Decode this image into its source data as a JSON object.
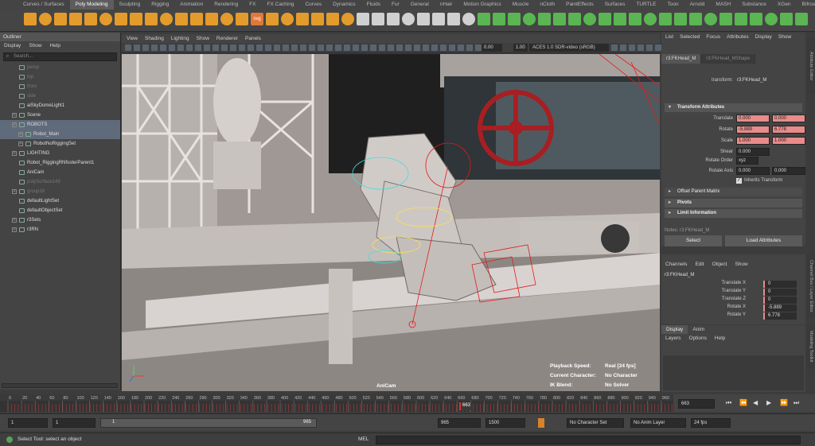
{
  "shelf": {
    "tabs": [
      "Curves / Surfaces",
      "Poly Modeling",
      "Sculpting",
      "Rigging",
      "Animation",
      "Rendering",
      "FX",
      "FX Caching",
      "Curves",
      "Dynamics",
      "Fluids",
      "Fur",
      "General",
      "nHair",
      "Motion Graphics",
      "Muscle",
      "nCloth",
      "PaintEffects",
      "Surfaces",
      "TURTLE",
      "Toon",
      "Arnold",
      "MASH",
      "Substance",
      "XGen",
      "Bifrost"
    ],
    "active_tab": "Poly Modeling",
    "svg_label": "svg"
  },
  "outliner": {
    "title": "Outliner",
    "menu": [
      "Display",
      "Show",
      "Help"
    ],
    "search_placeholder": "Search...",
    "items": [
      {
        "label": "persp",
        "dim": true,
        "exp": false,
        "child": false
      },
      {
        "label": "top",
        "dim": true,
        "exp": false,
        "child": false
      },
      {
        "label": "front",
        "dim": true,
        "exp": false,
        "child": false
      },
      {
        "label": "side",
        "dim": true,
        "exp": false,
        "child": false
      },
      {
        "label": "aiSkyDomeLight1",
        "dim": false,
        "exp": false,
        "child": false
      },
      {
        "label": "Scene",
        "dim": false,
        "exp": true,
        "child": false
      },
      {
        "label": "ROBOTS",
        "dim": false,
        "exp": true,
        "child": false,
        "sel": true
      },
      {
        "label": "Robot_Main",
        "dim": false,
        "exp": true,
        "child": true,
        "sel": true
      },
      {
        "label": "RobotNoRiggingSet",
        "dim": false,
        "exp": true,
        "child": true
      },
      {
        "label": "LIGHTING",
        "dim": false,
        "exp": true,
        "child": false
      },
      {
        "label": "Robot_RiggingRNfosterParent1",
        "dim": false,
        "exp": false,
        "child": false
      },
      {
        "label": "AniCam",
        "dim": false,
        "exp": false,
        "child": false
      },
      {
        "label": "polySurface149",
        "dim": true,
        "exp": false,
        "child": false
      },
      {
        "label": "group18",
        "dim": true,
        "exp": true,
        "child": false
      },
      {
        "label": "defaultLightSet",
        "dim": false,
        "exp": false,
        "child": false
      },
      {
        "label": "defaultObjectSet",
        "dim": false,
        "exp": false,
        "child": false
      },
      {
        "label": "r3Sets",
        "dim": false,
        "exp": true,
        "child": false
      },
      {
        "label": "r3RN",
        "dim": false,
        "exp": true,
        "child": false
      }
    ]
  },
  "viewport": {
    "menu": [
      "View",
      "Shading",
      "Lighting",
      "Show",
      "Renderer",
      "Panels"
    ],
    "num1": "0.00",
    "num2": "1.00",
    "colorspace": "ACES 1.0 SDR-video (sRGB)",
    "camera_name": "AniCam",
    "hud": [
      {
        "label": "Playback Speed:",
        "value": "Real [24 fps]"
      },
      {
        "label": "Current Character:",
        "value": "No Character"
      },
      {
        "label": "IK Blend:",
        "value": "No Solver"
      }
    ]
  },
  "attribute_editor": {
    "menu": [
      "List",
      "Selected",
      "Focus",
      "Attributes",
      "Display",
      "Show"
    ],
    "tabs": [
      "r3:FKHead_M",
      "r3:FKHead_MShape"
    ],
    "transform_label": "transform:",
    "transform_value": "r3:FKHead_M",
    "section_transform": "Transform Attributes",
    "fields": [
      {
        "label": "Translate",
        "values": [
          "0.000",
          "0.000"
        ],
        "red": true
      },
      {
        "label": "Rotate",
        "values": [
          "-5.889",
          "6.778"
        ],
        "red": true
      },
      {
        "label": "Scale",
        "values": [
          "1.000",
          "1.000"
        ],
        "red": true
      },
      {
        "label": "Shear",
        "values": [
          "0.000"
        ],
        "red": false
      }
    ],
    "rotate_order_label": "Rotate Order",
    "rotate_order_value": "xyz",
    "rotate_axis_label": "Rotate Axis",
    "rotate_axis_values": [
      "0.000",
      "0.000"
    ],
    "inherits_label": "Inherits Transform",
    "offset_label": "Offset Parent Matrix",
    "pivots_label": "Pivots",
    "limit_label": "Limit Information",
    "notes_label": "Notes: r3:FKHead_M",
    "select_btn": "Select",
    "load_btn": "Load Attributes",
    "side_tab": "Attribute Editor"
  },
  "channel_box": {
    "menu": [
      "Channels",
      "Edit",
      "Object",
      "Show"
    ],
    "object": "r3:FKHead_M",
    "channels": [
      {
        "label": "Translate X",
        "value": "0"
      },
      {
        "label": "Translate Y",
        "value": "0"
      },
      {
        "label": "Translate Z",
        "value": "0"
      },
      {
        "label": "Rotate X",
        "value": "-5.889"
      },
      {
        "label": "Rotate Y",
        "value": "6.778"
      }
    ],
    "side_tab": "Channel Box / Layer Editor",
    "side_tab2": "Modeling Toolkit"
  },
  "layer_editor": {
    "tabs": [
      "Display",
      "Anim"
    ],
    "menu": [
      "Layers",
      "Options",
      "Help"
    ]
  },
  "timeline": {
    "ticks": [
      "0",
      "20",
      "40",
      "60",
      "80",
      "100",
      "120",
      "140",
      "160",
      "180",
      "200",
      "220",
      "240",
      "260",
      "280",
      "300",
      "320",
      "340",
      "360",
      "380",
      "400",
      "420",
      "440",
      "460",
      "480",
      "500",
      "520",
      "540",
      "560",
      "580",
      "600",
      "620",
      "640",
      "660",
      "680",
      "700",
      "720",
      "740",
      "760",
      "780",
      "800",
      "820",
      "840",
      "860",
      "880",
      "900",
      "920",
      "940",
      "960"
    ],
    "current_frame": "663",
    "current_field": "663"
  },
  "range": {
    "start": "1",
    "anim_start": "1",
    "slider_start": "1",
    "slider_end": "965",
    "anim_end": "965",
    "end": "1500",
    "character_set": "No Character Set",
    "anim_layer": "No Anim Layer",
    "fps": "24 fps"
  },
  "status": {
    "message": "Select Tool: select an object",
    "mel_label": "MEL"
  }
}
